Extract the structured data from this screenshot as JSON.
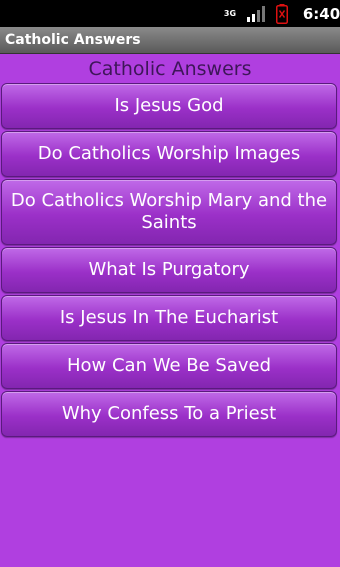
{
  "status_bar": {
    "network": "3G",
    "signal_icon": "signal-bars-icon",
    "battery_icon": "battery-alert-icon",
    "time": "6:40"
  },
  "app_bar": {
    "title": "Catholic Answers"
  },
  "heading": "Catholic Answers",
  "menu_items": [
    "Is Jesus God",
    "Do Catholics Worship Images",
    "Do Catholics Worship Mary and the Saints",
    "What Is Purgatory",
    "Is Jesus In The Eucharist",
    "How Can We Be Saved",
    "Why Confess To a Priest"
  ],
  "colors": {
    "background": "#b03fe0",
    "button": "#9b30c8",
    "heading_text": "#3e1659"
  }
}
